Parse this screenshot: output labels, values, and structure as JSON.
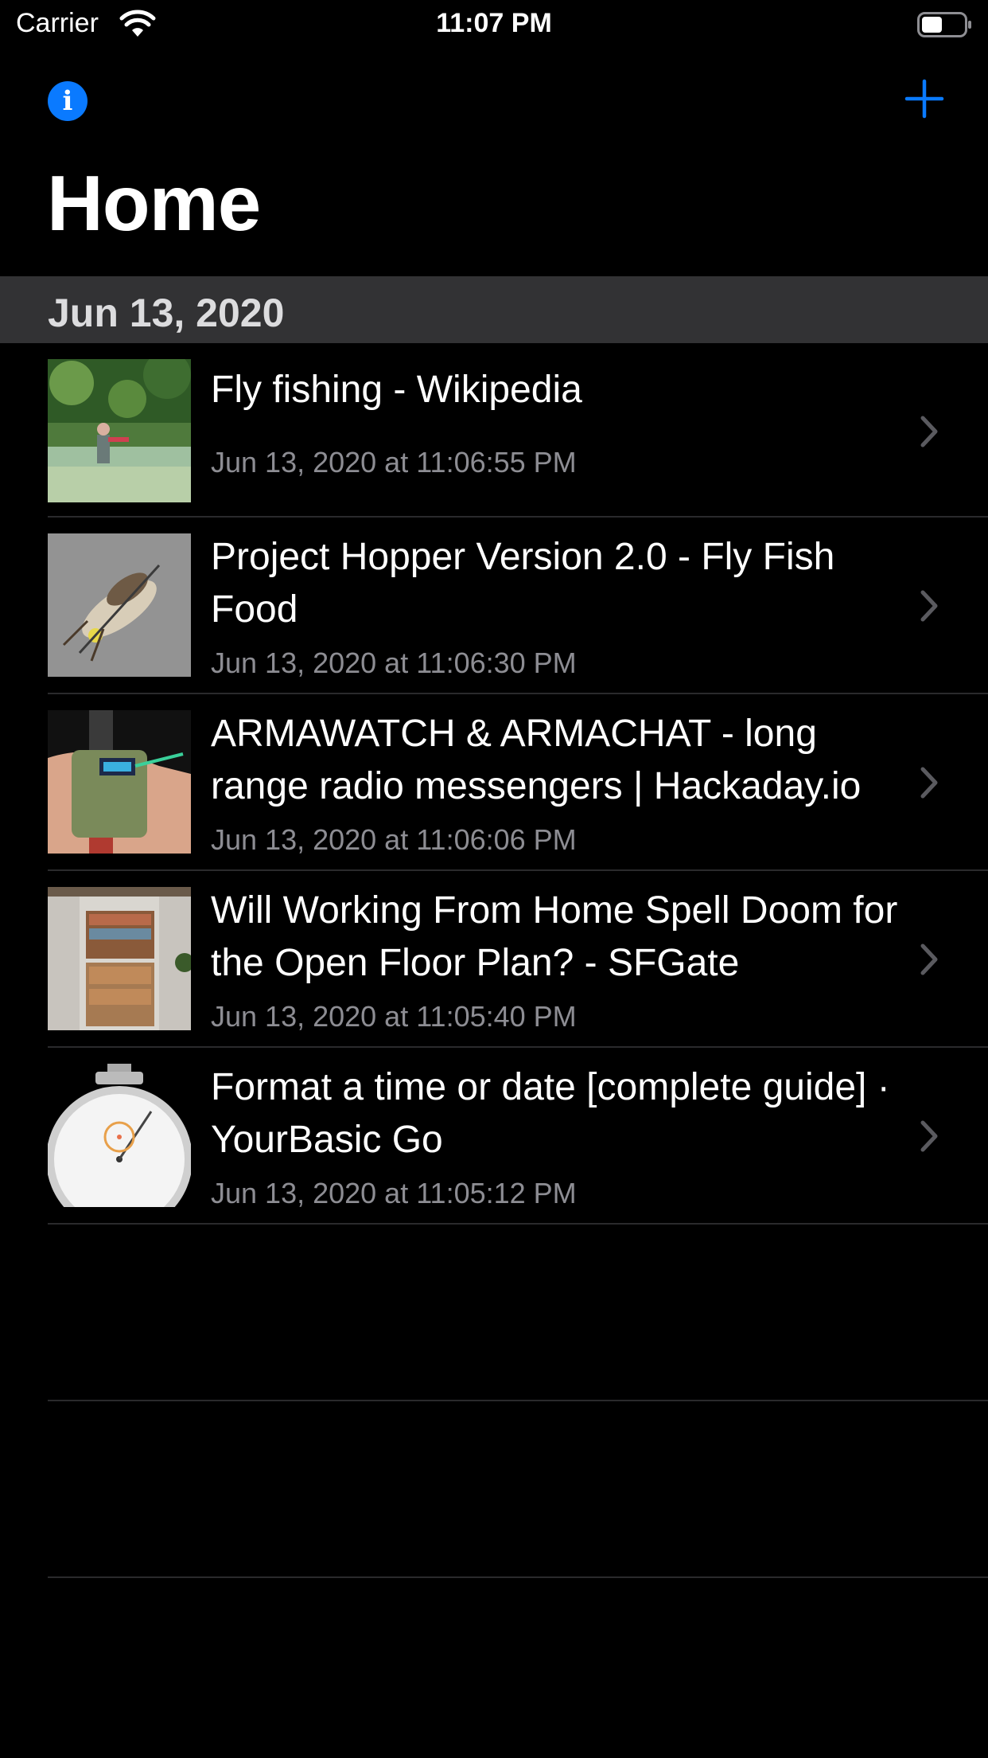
{
  "status_bar": {
    "carrier": "Carrier",
    "time": "11:07 PM"
  },
  "nav": {
    "info_icon": "info-icon",
    "add_icon": "plus-icon",
    "accent_color": "#0a7aff"
  },
  "page_title": "Home",
  "section": {
    "header": "Jun 13, 2020",
    "items": [
      {
        "title": "Fly fishing - Wikipedia",
        "subtitle": "Jun 13, 2020 at 11:06:55 PM"
      },
      {
        "title": "Project Hopper Version 2.0 - Fly Fish Food",
        "subtitle": "Jun 13, 2020 at 11:06:30 PM"
      },
      {
        "title": "ARMAWATCH & ARMACHAT - long range radio messengers | Hackaday.io",
        "subtitle": "Jun 13, 2020 at 11:06:06 PM"
      },
      {
        "title": "Will Working From Home Spell Doom for the Open Floor Plan? - SFGate",
        "subtitle": "Jun 13, 2020 at 11:05:40 PM"
      },
      {
        "title": "Format a time or date [complete guide] · YourBasic Go",
        "subtitle": "Jun 13, 2020 at 11:05:12 PM"
      }
    ]
  }
}
